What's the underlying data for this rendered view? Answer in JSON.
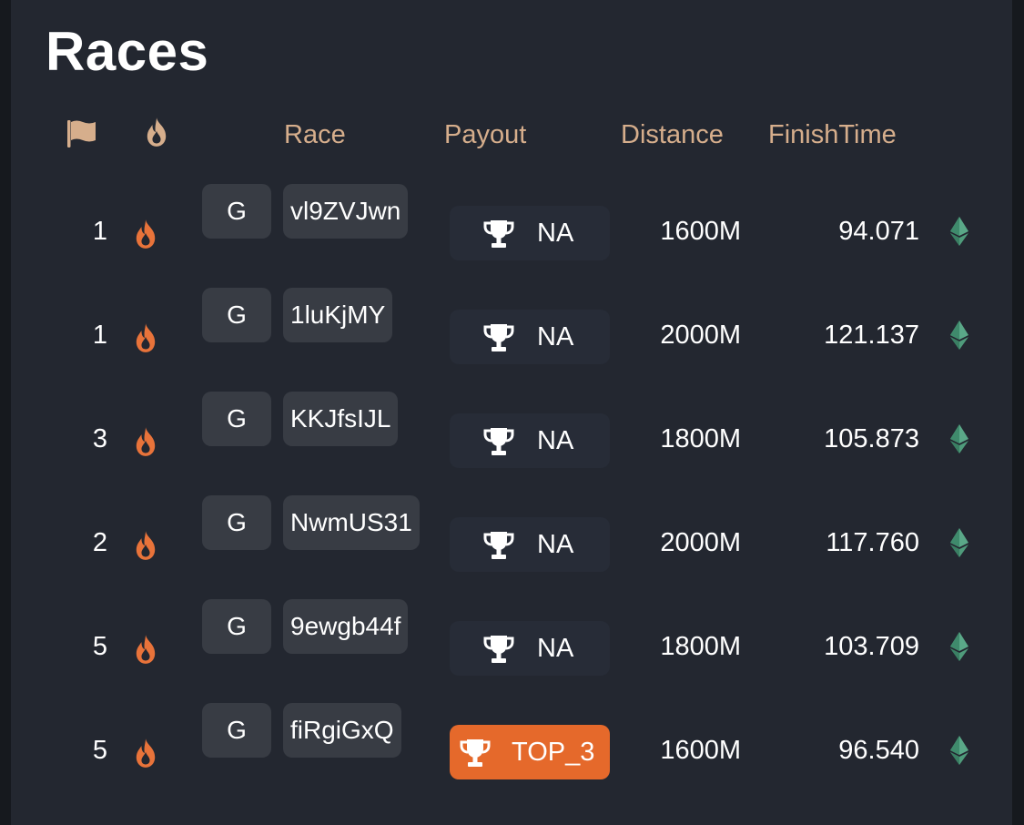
{
  "page": {
    "title": "Races"
  },
  "columns": {
    "position_icon": "flag-icon",
    "fire_icon": "flame-icon",
    "race": "Race",
    "payout": "Payout",
    "distance": "Distance",
    "finish_time": "FinishTime"
  },
  "colors": {
    "header_text": "#d6ae8c",
    "flame": "#e8733a",
    "payout_highlight": "#e5692b",
    "eth_icon": "#4f9b7b"
  },
  "rows": [
    {
      "position": "1",
      "grade": "G",
      "race_id": "vl9ZVJwn",
      "payout": "NA",
      "distance": "1600M",
      "finish_time": "94.071",
      "highlight": false
    },
    {
      "position": "1",
      "grade": "G",
      "race_id": "1luKjMY",
      "payout": "NA",
      "distance": "2000M",
      "finish_time": "121.137",
      "highlight": false
    },
    {
      "position": "3",
      "grade": "G",
      "race_id": "KKJfsIJL",
      "payout": "NA",
      "distance": "1800M",
      "finish_time": "105.873",
      "highlight": false
    },
    {
      "position": "2",
      "grade": "G",
      "race_id": "NwmUS31",
      "payout": "NA",
      "distance": "2000M",
      "finish_time": "117.760",
      "highlight": false
    },
    {
      "position": "5",
      "grade": "G",
      "race_id": "9ewgb44f",
      "payout": "NA",
      "distance": "1800M",
      "finish_time": "103.709",
      "highlight": false
    },
    {
      "position": "5",
      "grade": "G",
      "race_id": "fiRgiGxQ",
      "payout": "TOP_3",
      "distance": "1600M",
      "finish_time": "96.540",
      "highlight": true
    }
  ]
}
